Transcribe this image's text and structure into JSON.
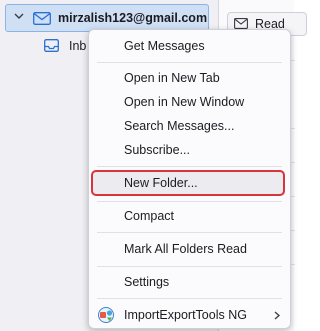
{
  "folder_pane": {
    "account_name": "mirzalish123@gmail.com",
    "inbox_label": "Inb"
  },
  "message_pane": {
    "read_label": "Read"
  },
  "menu": {
    "items": [
      {
        "label": "Get Messages"
      },
      {
        "label": "Open in New Tab"
      },
      {
        "label": "Open in New Window"
      },
      {
        "label": "Search Messages..."
      },
      {
        "label": "Subscribe..."
      },
      {
        "label": "New Folder..."
      },
      {
        "label": "Compact"
      },
      {
        "label": "Mark All Folders Read"
      },
      {
        "label": "Settings"
      },
      {
        "label": "ImportExportTools NG"
      }
    ],
    "highlighted_item": "New Folder...",
    "highlight_color": "#d8343b"
  },
  "icons": {
    "account": "mail-account-icon",
    "inbox": "inbox-icon",
    "read": "envelope-read-icon",
    "addon": "importexport-addon-icon",
    "submenu": "chevron-right-icon"
  }
}
